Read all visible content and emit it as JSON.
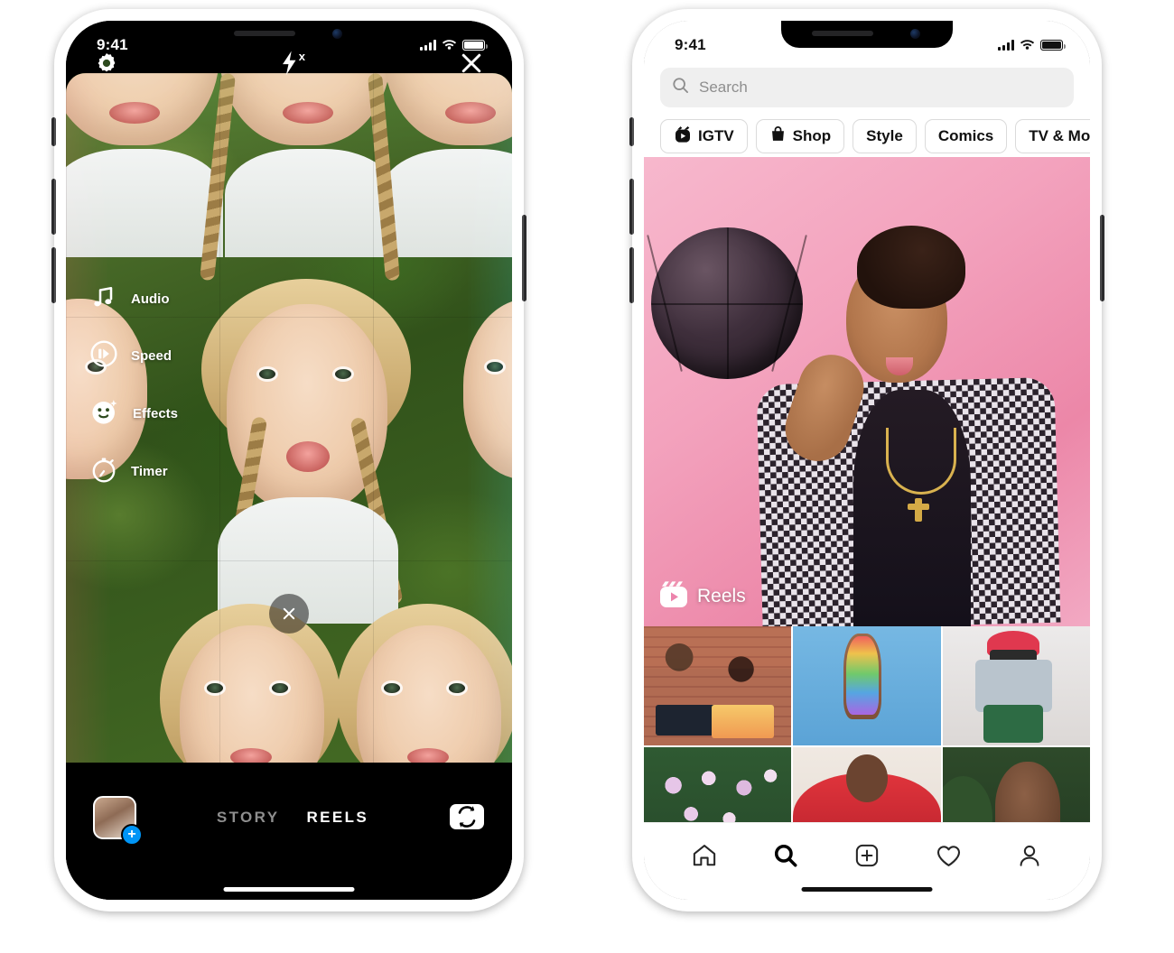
{
  "background_color": "#ffffff",
  "left_phone": {
    "name": "instagram-reels-camera",
    "status_bar": {
      "time": "9:41",
      "cellular": "signal-bars-icon",
      "wifi": "wifi-icon",
      "battery": "battery-full-icon"
    },
    "top_controls": [
      {
        "name": "settings-gear",
        "icon": "gear-icon",
        "label": "Settings"
      },
      {
        "name": "flash-off",
        "icon": "flash-off-icon",
        "label": "Flash off"
      },
      {
        "name": "close",
        "icon": "close-icon",
        "label": "Close"
      }
    ],
    "tools": [
      {
        "icon": "music-note-icon",
        "label": "Audio"
      },
      {
        "icon": "speed-play-icon",
        "label": "Speed"
      },
      {
        "icon": "smiley-sparkle-icon",
        "label": "Effects"
      },
      {
        "icon": "timer-icon",
        "label": "Timer"
      }
    ],
    "clear_effect_button": {
      "icon": "close-icon",
      "label": "Clear effect"
    },
    "effect_carousel": [
      {
        "name": "reels-shutter",
        "icon": "reels-icon",
        "selected": true
      },
      {
        "name": "effect-confetti",
        "icon": "confetti-effect-icon",
        "color": "#e81b5f",
        "selected": false
      },
      {
        "name": "effect-lens",
        "icon": "lens-effect-icon",
        "color": "#6b17c4",
        "selected": false
      }
    ],
    "bottom_bar": {
      "gallery_thumb": {
        "name": "gallery-thumbnail",
        "badge": "+"
      },
      "modes": [
        {
          "label": "STORY",
          "active": false
        },
        {
          "label": "REELS",
          "active": true
        }
      ],
      "flip_camera": {
        "icon": "camera-flip-icon",
        "label": "Flip camera"
      }
    }
  },
  "right_phone": {
    "name": "instagram-explore",
    "status_bar": {
      "time": "9:41",
      "cellular": "signal-bars-icon",
      "wifi": "wifi-icon",
      "battery": "battery-full-icon"
    },
    "search": {
      "placeholder": "Search",
      "value": "",
      "icon": "search-icon"
    },
    "chips": [
      {
        "label": "IGTV",
        "icon": "igtv-icon"
      },
      {
        "label": "Shop",
        "icon": "shopping-bag-icon"
      },
      {
        "label": "Style",
        "icon": ""
      },
      {
        "label": "Comics",
        "icon": ""
      },
      {
        "label": "TV & Movies",
        "icon": ""
      }
    ],
    "hero": {
      "badge_label": "Reels",
      "badge_icon": "reels-icon",
      "alt": "person-with-basketball-photo",
      "background_color": "#f2a0bd"
    },
    "grid_items": [
      {
        "name": "grid-item-1",
        "alt": "two-people-at-table-photo"
      },
      {
        "name": "grid-item-2",
        "alt": "rhinestone-hand-sky-photo"
      },
      {
        "name": "grid-item-3",
        "alt": "person-in-beanie-photo"
      },
      {
        "name": "grid-item-4",
        "alt": "flowers-photo"
      },
      {
        "name": "grid-item-5",
        "alt": "person-in-red-hoodie-photo"
      },
      {
        "name": "grid-item-6",
        "alt": "person-with-greenery-photo"
      }
    ],
    "tab_bar": [
      {
        "name": "tab-home",
        "icon": "home-icon",
        "active": false
      },
      {
        "name": "tab-search",
        "icon": "search-icon",
        "active": true
      },
      {
        "name": "tab-create",
        "icon": "plus-square-icon",
        "active": false
      },
      {
        "name": "tab-activity",
        "icon": "heart-icon",
        "active": false
      },
      {
        "name": "tab-profile",
        "icon": "person-icon",
        "active": false
      }
    ]
  }
}
